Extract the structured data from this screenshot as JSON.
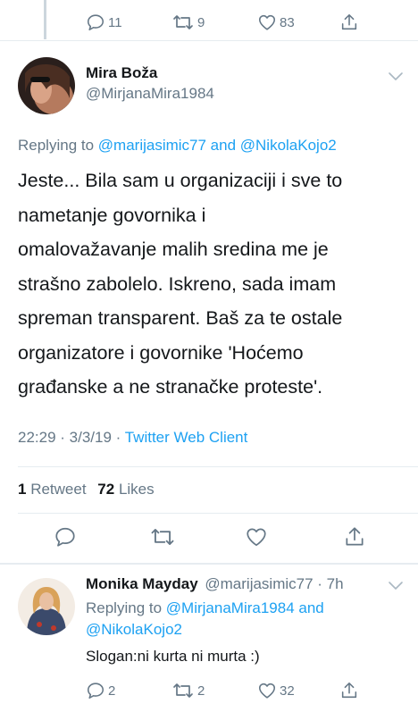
{
  "prev_tweet": {
    "reply_count": "11",
    "retweet_count": "9",
    "like_count": "83"
  },
  "main_tweet": {
    "author_name": "Mira Boža",
    "author_handle": "@MirjanaMira1984",
    "replying_prefix": "Replying to ",
    "reply_to_1": "@marijasimic77",
    "reply_and": " and ",
    "reply_to_2": "@NikolaKojo2",
    "text_lines": [
      "Jeste... Bila sam u organizaciji i sve to",
      "nametanje govornika i",
      "omalovažavanje malih sredina me je",
      "strašno zabolelo. Iskreno, sada imam",
      "spreman transparent. Baš za te ostale",
      "organizatore i govornike 'Hoćemo",
      "građanske a ne stranačke proteste'."
    ],
    "time": "22:29",
    "sep1": " · ",
    "date": "3/3/19",
    "sep2": " · ",
    "client": "Twitter Web Client",
    "retweets_num": "1",
    "retweets_label": " Retweet",
    "likes_num": "72",
    "likes_label": " Likes"
  },
  "reply_tweet": {
    "author_name": "Monika Mayday",
    "author_handle": "@marijasimic77",
    "sep": " · ",
    "age": "7h",
    "replying_prefix": "Replying to ",
    "reply_to_1": "@MirjanaMira1984",
    "reply_and": " and",
    "reply_to_2": "@NikolaKojo2",
    "text": "Slogan:ni kurta ni murta :)",
    "reply_count": "2",
    "retweet_count": "2",
    "like_count": "32"
  },
  "colors": {
    "text": "#14171a",
    "secondary": "#657786",
    "link": "#1da1f2",
    "divider": "#e6ecf0"
  }
}
